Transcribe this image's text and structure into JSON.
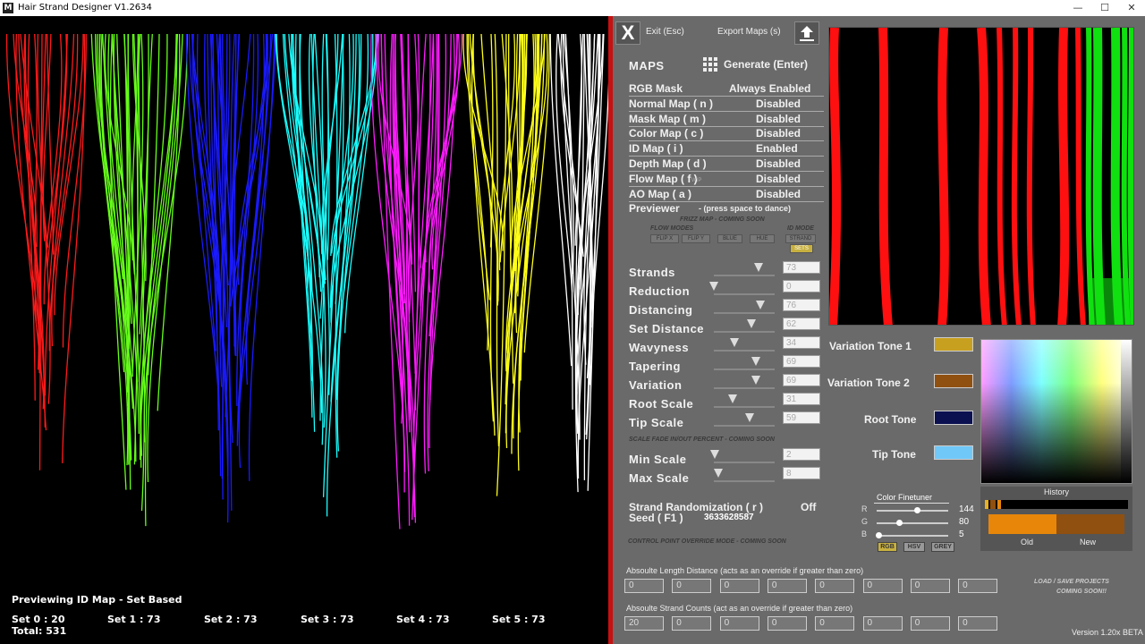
{
  "titlebar": {
    "title": "Hair Strand Designer V1.2634",
    "icon": "app-icon",
    "minimize": "—",
    "maximize": "☐",
    "close": "✕"
  },
  "viewport": {
    "status": "Previewing ID Map - Set Based",
    "sets": [
      {
        "label": "Set 0 : 20",
        "color": "#ff1a1a"
      },
      {
        "label": "Set 1 : 73",
        "color": "#66ff1a"
      },
      {
        "label": "Set 2 : 73",
        "color": "#1a1aff"
      },
      {
        "label": "Set 3 : 73",
        "color": "#1affff"
      },
      {
        "label": "Set 4 : 73",
        "color": "#ff1aff"
      },
      {
        "label": "Set 5 : 73",
        "color": "#ffff1a"
      },
      {
        "label": "",
        "color": "#ffffff"
      }
    ],
    "total": "Total:  531"
  },
  "panel": {
    "close_label": "X",
    "exit_label": "Exit (Esc)",
    "export_label": "Export Maps (s)",
    "export_icon": "upload-icon",
    "maps_heading": "MAPS",
    "generate_icon": "grid-icon",
    "generate_label": "Generate (Enter)",
    "maps": [
      {
        "name": "RGB Mask",
        "value": "Always Enabled"
      },
      {
        "name": "Normal Map  ( n )",
        "value": "Disabled"
      },
      {
        "name": "Mask Map   ( m )",
        "value": "Disabled"
      },
      {
        "name": "Color Map   ( c )",
        "value": "Disabled"
      },
      {
        "name": "ID Map       ( i )",
        "value": "Enabled"
      },
      {
        "name": "Depth Map   ( d )",
        "value": "Disabled"
      },
      {
        "name": "Flow Map      ( f )",
        "value": "Disabled"
      },
      {
        "name": "AO Map      ( a )",
        "value": "Disabled"
      }
    ],
    "flow_wip": "WIP",
    "previewer": "Previewer",
    "previewer_hint": "- (press space to dance)",
    "frizz": "FRIZZ MAP - COMING SOON",
    "flow_modes_label": "FLOW MODES",
    "flow_modes": [
      "FLIP X",
      "FLIP Y",
      "BLUE",
      "HUE"
    ],
    "id_mode_label": "ID MODE",
    "id_modes": [
      "STRAND",
      "SETS"
    ],
    "sliders": [
      {
        "label": "Strands",
        "value": "73",
        "fraction": 0.73
      },
      {
        "label": "Reduction",
        "value": "0",
        "fraction": 0.0
      },
      {
        "label": "Distancing",
        "value": "76",
        "fraction": 0.76
      },
      {
        "label": "Set Distance",
        "value": "62",
        "fraction": 0.62
      },
      {
        "label": "Wavyness",
        "value": "34",
        "fraction": 0.34
      },
      {
        "label": "Tapering",
        "value": "69",
        "fraction": 0.69
      },
      {
        "label": "Variation",
        "value": "69",
        "fraction": 0.69
      },
      {
        "label": "Root Scale",
        "value": "31",
        "fraction": 0.31
      },
      {
        "label": "Tip Scale",
        "value": "59",
        "fraction": 0.59
      }
    ],
    "scale_fade": "SCALE FADE IN/OUT PERCENT - COMING SOON",
    "scale_sliders": [
      {
        "label": "Min Scale",
        "value": "2",
        "fraction": 0.02
      },
      {
        "label": "Max Scale",
        "value": "8",
        "fraction": 0.08
      }
    ],
    "randomization_label": "Strand Randomization ( r )",
    "randomization_value": "Off",
    "seed_label": "Seed ( F1 )",
    "seed_value": "3633628587",
    "control_point": "CONTROL POINT OVERRIDE MODE - COMING SOON",
    "abs_length_label": "Absoulte Length Distance (acts as an override if greater than zero)",
    "abs_length_values": [
      "0",
      "0",
      "0",
      "0",
      "0",
      "0",
      "0",
      "0"
    ],
    "abs_count_label": "Absoulte Strand Counts (act as an override if greater than zero)",
    "abs_count_values": [
      "20",
      "0",
      "0",
      "0",
      "0",
      "0",
      "0",
      "0"
    ],
    "load_save": "LOAD / SAVE PROJECTS",
    "load_save_soon": "COMING SOON!!",
    "version": "Version 1.20x BETA",
    "tones": [
      {
        "label": "Variation Tone 1",
        "color": "#c8a020"
      },
      {
        "label": "Variation Tone 2",
        "color": "#905010"
      },
      {
        "label": "Root Tone",
        "color": "#0a1050"
      },
      {
        "label": "Tip Tone",
        "color": "#70c8f8"
      }
    ],
    "finetuner": {
      "title": "Color Finetuner",
      "channels": [
        {
          "label": "R",
          "value": "144",
          "fraction": 0.565
        },
        {
          "label": "G",
          "value": "80",
          "fraction": 0.314
        },
        {
          "label": "B",
          "value": "5",
          "fraction": 0.02
        }
      ],
      "modes": [
        "RGB",
        "HSV",
        "GREY"
      ]
    },
    "history": {
      "title": "History",
      "old_label": "Old",
      "new_label": "New",
      "old_color": "#e8860a",
      "new_color": "#905010"
    }
  }
}
